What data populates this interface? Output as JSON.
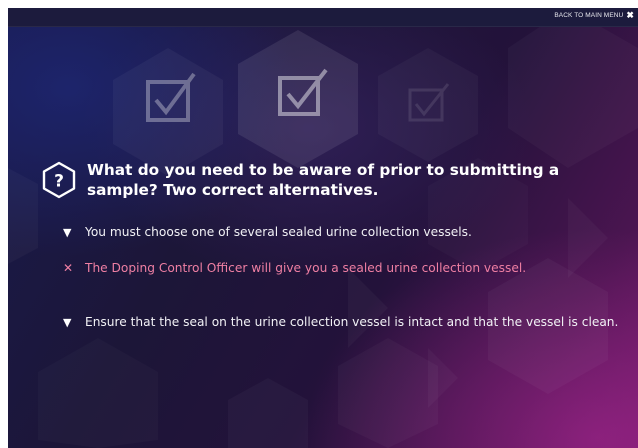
{
  "topbar": {
    "back_label": "BACK TO MAIN MENU",
    "close_symbol": "✖"
  },
  "question": {
    "icon": "question-mark-hexagon-icon",
    "text": "What do you need to be aware of prior to submitting a sample? Two correct alternatives."
  },
  "answers": [
    {
      "marker": "▼",
      "text": "You must choose one of several sealed urine collection vessels.",
      "status": "correct"
    },
    {
      "marker": "✕",
      "text": "The Doping Control Officer will give you a sealed urine collection vessel.",
      "status": "incorrect"
    },
    {
      "marker": "▼",
      "text": "Ensure that the seal on the urine collection vessel is intact and that the vessel is clean.",
      "status": "correct"
    }
  ],
  "colors": {
    "correct_text": "#f2f2f6",
    "incorrect_text": "#ef7fa3",
    "topbar": "#1c1b3d"
  }
}
